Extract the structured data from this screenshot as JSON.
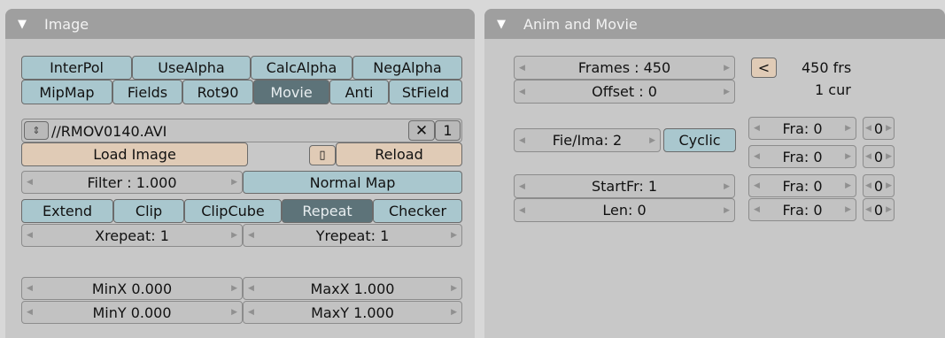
{
  "image_panel": {
    "title": "Image",
    "row1": [
      "InterPol",
      "UseAlpha",
      "CalcAlpha",
      "NegAlpha"
    ],
    "row2": [
      "MipMap",
      "Fields",
      "Rot90",
      "Movie",
      "Anti",
      "StField"
    ],
    "file": {
      "path": "//RMOV0140.AVI",
      "users": "1"
    },
    "load_image": "Load Image",
    "reload": "Reload",
    "filter": "Filter : 1.000",
    "normal_map": "Normal Map",
    "extend_row": [
      "Extend",
      "Clip",
      "ClipCube",
      "Repeat",
      "Checker"
    ],
    "xrepeat": "Xrepeat: 1",
    "yrepeat": "Yrepeat: 1",
    "minx": "MinX 0.000",
    "maxx": "MaxX 1.000",
    "miny": "MinY 0.000",
    "maxy": "MaxY 1.000"
  },
  "anim_panel": {
    "title": "Anim and Movie",
    "frames": "Frames : 450",
    "offset": "Offset : 0",
    "set_button": "<",
    "frs": "450 frs",
    "cur": "1 cur",
    "fie_ima": "Fie/Ima: 2",
    "cyclic": "Cyclic",
    "startfr": "StartFr: 1",
    "len": "Len: 0",
    "fra": [
      "Fra: 0",
      "Fra: 0",
      "Fra: 0",
      "Fra: 0"
    ],
    "fra_val": [
      "0",
      "0",
      "0",
      "0"
    ]
  },
  "colors": {
    "toggle": "#a9c7ce",
    "toggle_active": "#5d7379",
    "action_beige": "#e0cbb6",
    "number_field": "#c2c2c2",
    "header": "#9f9f9f"
  }
}
